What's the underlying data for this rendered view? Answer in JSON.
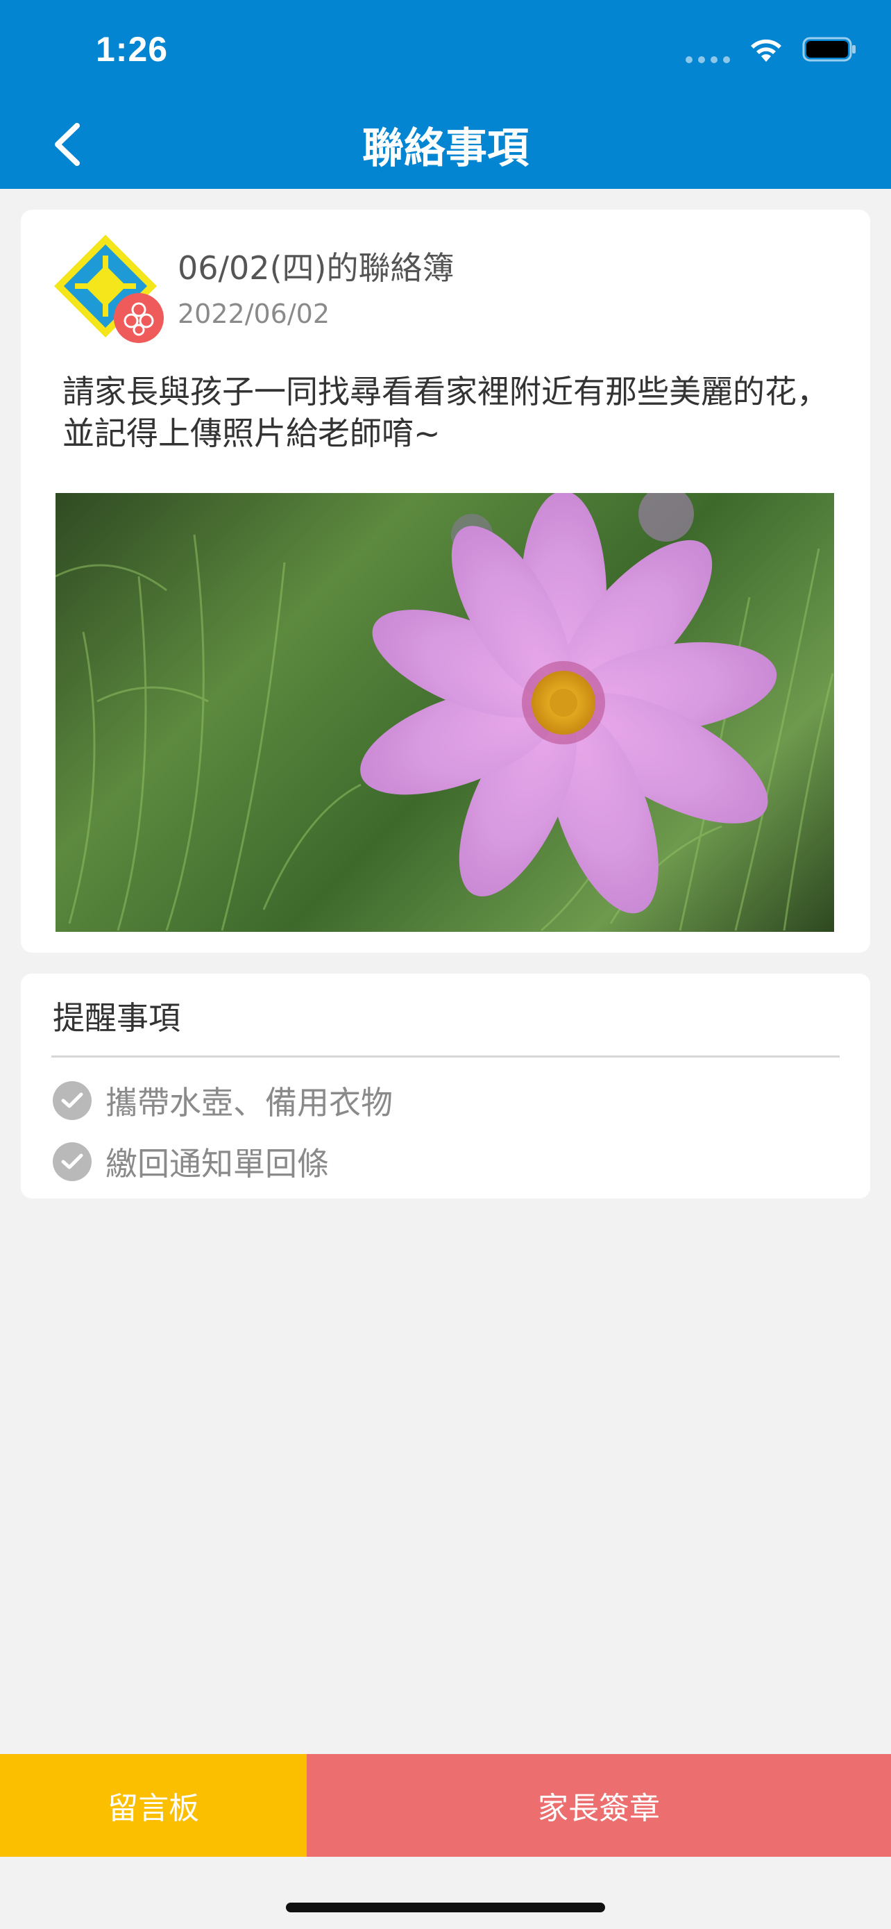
{
  "status_bar": {
    "time": "1:26"
  },
  "header": {
    "title": "聯絡事項",
    "back_icon": "chevron-left-icon"
  },
  "entry": {
    "title": "06/02(四)的聯絡簿",
    "date": "2022/06/02",
    "body": "請家長與孩子一同找尋看看家裡附近有那些美麗的花，並記得上傳照片給老師唷~",
    "photo_subject": "pink cosmos flower"
  },
  "reminders": {
    "heading": "提醒事項",
    "items": [
      {
        "label": "攜帶水壺、備用衣物"
      },
      {
        "label": "繳回通知單回條"
      }
    ]
  },
  "actions": {
    "message_board": "留言板",
    "parent_signature": "家長簽章"
  },
  "colors": {
    "header_bg": "#0485d1",
    "board_button": "#fbbf00",
    "sign_button": "#ec6e6e",
    "background": "#f2f2f2"
  }
}
